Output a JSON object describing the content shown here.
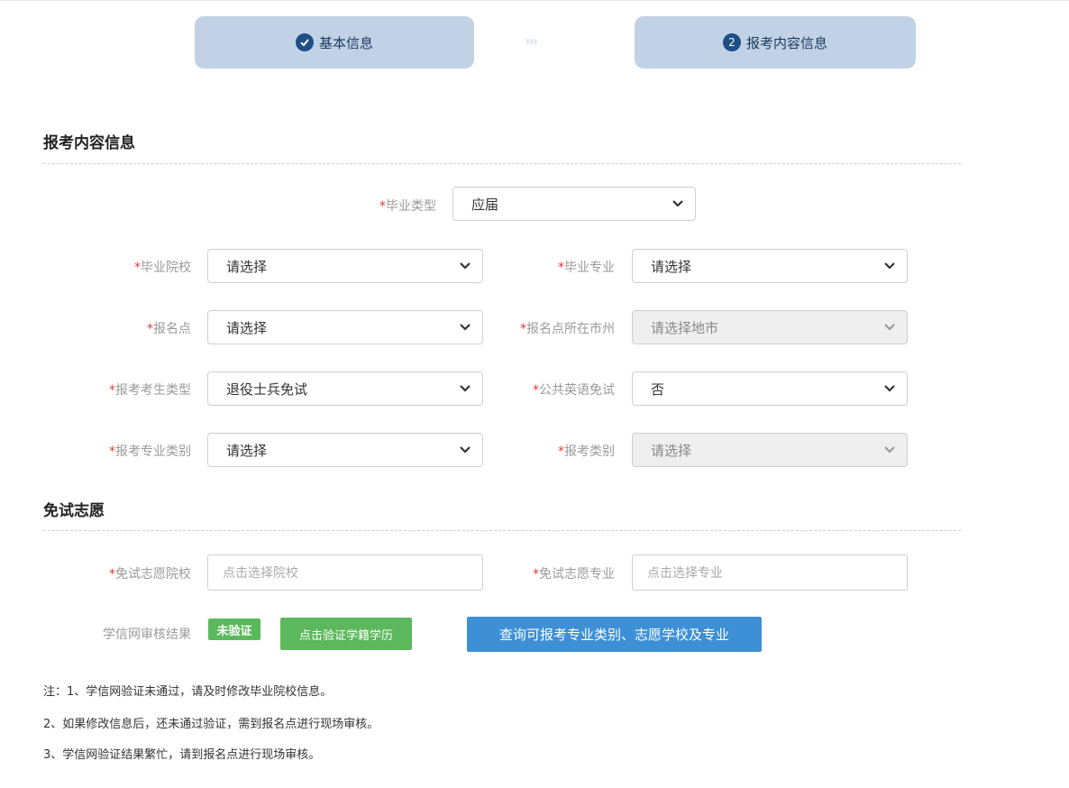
{
  "steps": [
    {
      "label": "基本信息",
      "marker": "check-circle-icon"
    },
    {
      "label": "报考内容信息",
      "number": "2"
    }
  ],
  "step_arrows": "›››",
  "sections": {
    "content_title": "报考内容信息",
    "exempt_title": "免试志愿"
  },
  "required_mark": "*",
  "fields": {
    "graduation_type": {
      "label": "毕业类型",
      "value": "应届"
    },
    "school": {
      "label": "毕业院校",
      "value": "请选择"
    },
    "major": {
      "label": "毕业专业",
      "value": "请选择"
    },
    "exam_site": {
      "label": "报名点",
      "value": "请选择"
    },
    "exam_site_city": {
      "label": "报名点所在市州",
      "value": "请选择地市"
    },
    "candidate_type": {
      "label": "报考考生类型",
      "value": "退役士兵免试"
    },
    "english_exempt": {
      "label": "公共英语免试",
      "value": "否"
    },
    "major_category": {
      "label": "报考专业类别",
      "value": "请选择"
    },
    "apply_category": {
      "label": "报考类别",
      "value": "请选择"
    },
    "exempt_school": {
      "label": "免试志愿院校",
      "placeholder": "点击选择院校"
    },
    "exempt_major": {
      "label": "免试志愿专业",
      "placeholder": "点击选择专业"
    }
  },
  "chsi": {
    "label": "学信网审核结果",
    "status": "未验证",
    "verify_button": "点击验证学籍学历",
    "query_button": "查询可报考专业类别、志愿学校及专业"
  },
  "notes": [
    "注：1、学信网验证未通过，请及时修改毕业院校信息。",
    "2、如果修改信息后，还未通过验证，需到报名点进行现场审核。",
    "3、学信网验证结果繁忙，请到报名点进行现场审核。"
  ],
  "colors": {
    "step_bg": "#c2d2e6",
    "step_marker": "#1e4f86",
    "required": "#e53935",
    "green": "#5cb85c",
    "blue": "#3d8fd6"
  }
}
